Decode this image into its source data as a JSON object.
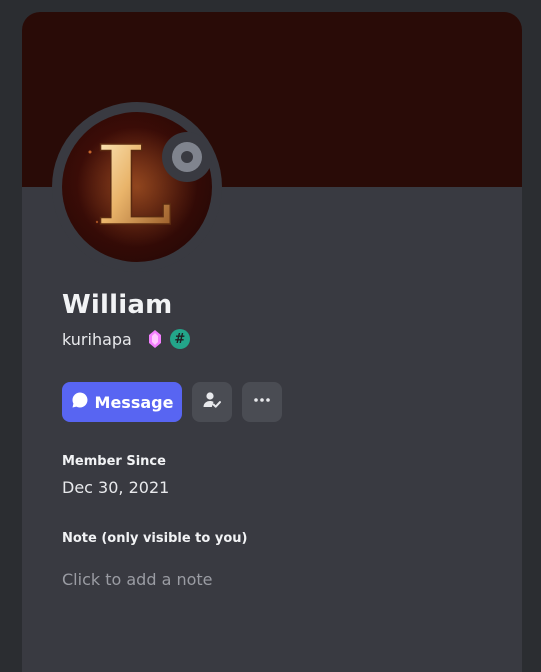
{
  "profile": {
    "display_name": "William",
    "username": "kurihapa",
    "avatar_letter": "L",
    "status": "offline",
    "badges": [
      {
        "name": "nitro-gem-icon",
        "color": "#f47fff"
      },
      {
        "name": "hash-badge-icon",
        "symbol": "#",
        "color": "#23a58a"
      }
    ]
  },
  "actions": {
    "message_label": "Message",
    "accent": "#5865f2"
  },
  "member_since": {
    "title": "Member Since",
    "date": "Dec 30, 2021"
  },
  "note": {
    "title": "Note (only visible to you)",
    "placeholder": "Click to add a note"
  },
  "colors": {
    "banner": "#290b07",
    "card": "#393a41",
    "background": "#2b2d31"
  }
}
